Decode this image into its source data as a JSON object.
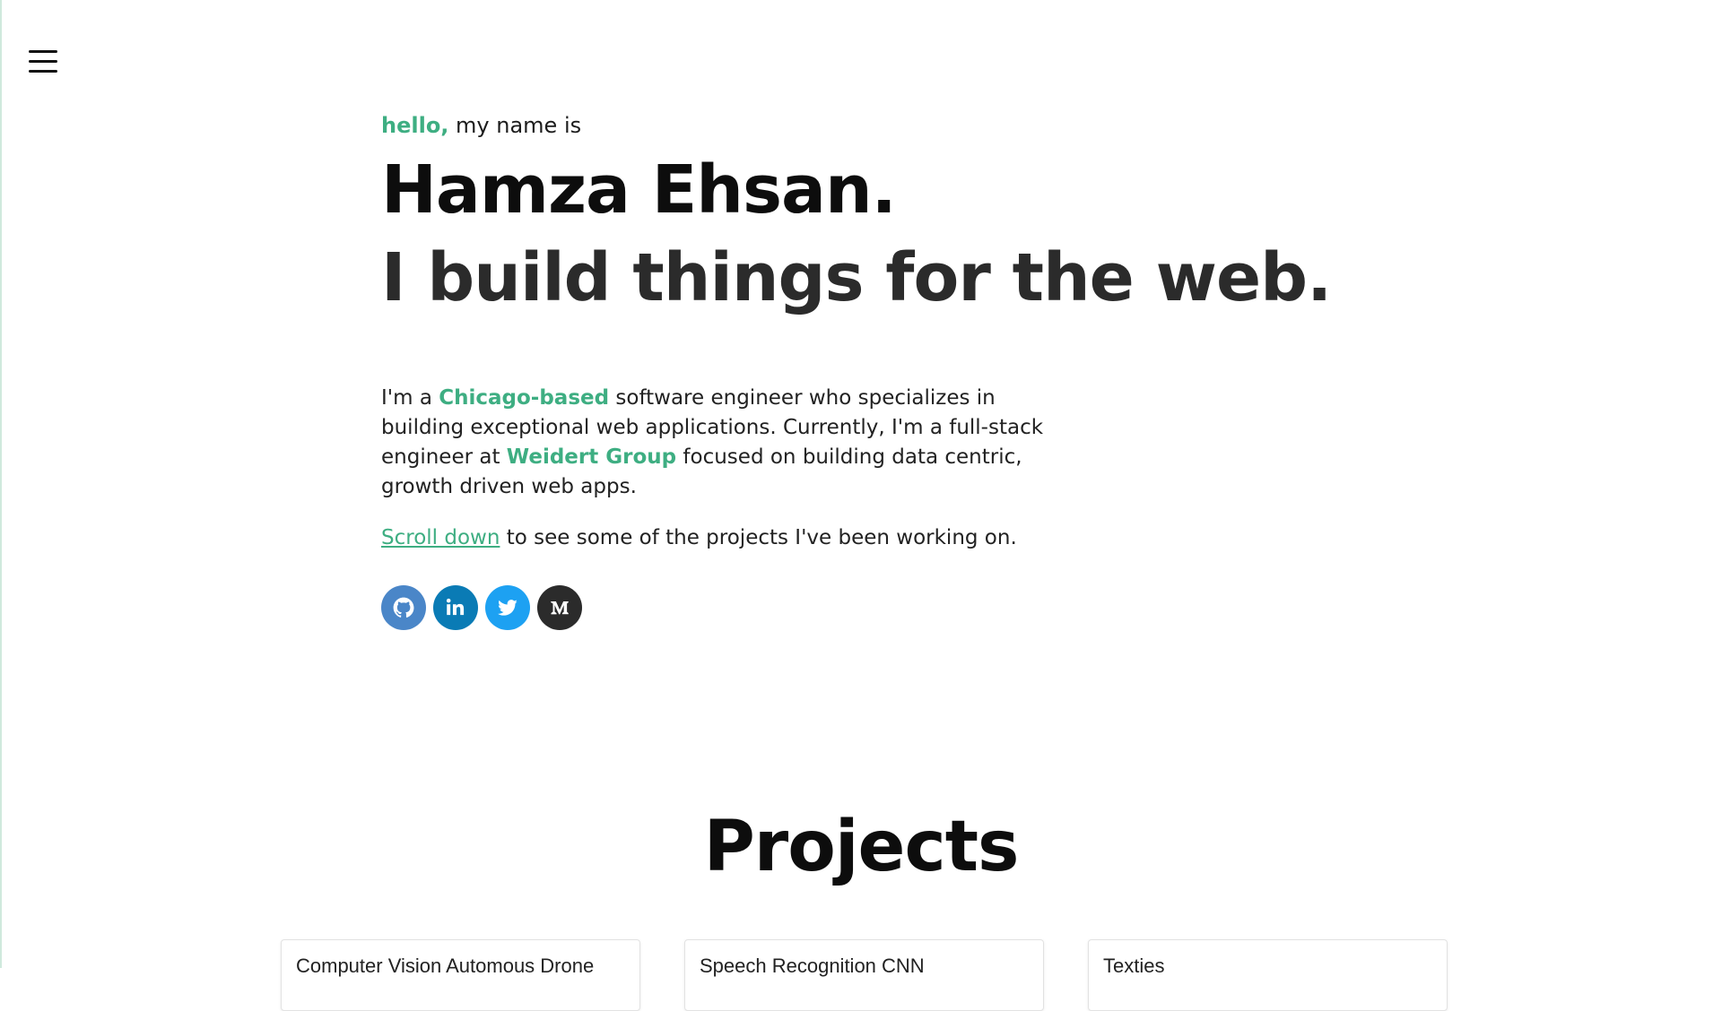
{
  "nav": {
    "menu_icon": "hamburger-menu-icon"
  },
  "hero": {
    "greeting_accent": "hello,",
    "greeting_rest": " my name is",
    "name": "Hamza Ehsan.",
    "tagline": "I build things for the web.",
    "bio": {
      "p1": "I'm a ",
      "location": "Chicago-based",
      "p2": " software engineer who specializes in building exceptional web applications. Currently, I'm a full-stack engineer at ",
      "company": "Weidert Group",
      "p3": " focused on building data centric, growth driven web apps."
    },
    "scroll_link": "Scroll down",
    "scroll_rest": " to see some of the projects I've been working on."
  },
  "socials": [
    {
      "icon": "github-icon",
      "color": "#4a86c8"
    },
    {
      "icon": "linkedin-icon",
      "color": "#0a7bb5"
    },
    {
      "icon": "twitter-icon",
      "color": "#1da1f2"
    },
    {
      "icon": "medium-icon",
      "color": "#2b2b2b"
    }
  ],
  "projects": {
    "title": "Projects",
    "cards": [
      {
        "title": "Computer Vision Automous Drone"
      },
      {
        "title": "Speech Recognition CNN"
      },
      {
        "title": "Texties"
      }
    ]
  },
  "colors": {
    "accent": "#3eae82"
  }
}
